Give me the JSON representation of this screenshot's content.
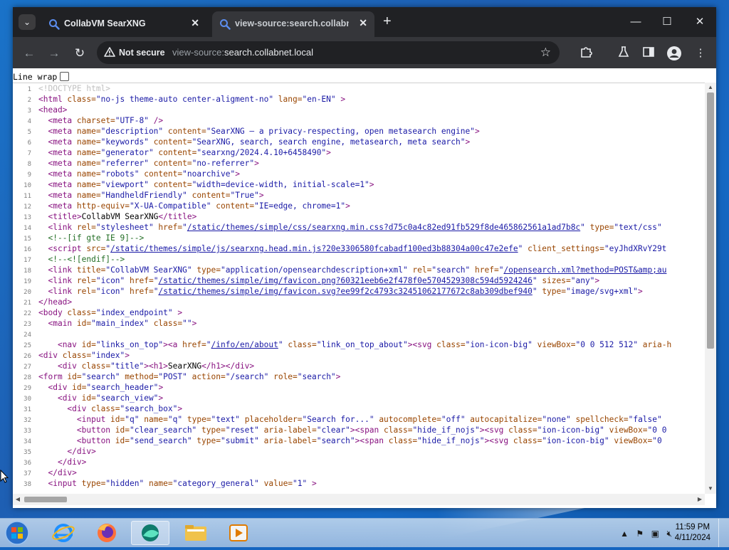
{
  "tabs": [
    {
      "title": "CollabVM SearXNG",
      "active": false
    },
    {
      "title": "view-source:search.collabnet.lo",
      "active": true
    }
  ],
  "window_controls": {
    "minimize": "—",
    "maximize": "☐",
    "close": "✕"
  },
  "address_bar": {
    "security_label": "Not secure",
    "url_scheme": "view-source:",
    "url_host": "search.collabnet.local"
  },
  "line_wrap_label": "Line wrap",
  "source_lines": [
    [
      [
        "doc",
        "<!DOCTYPE html>"
      ]
    ],
    [
      [
        "tag",
        "<html "
      ],
      [
        "attr",
        "class="
      ],
      [
        "val",
        "\"no-js theme-auto center-aligment-no\""
      ],
      [
        "attr",
        " lang="
      ],
      [
        "val",
        "\"en-EN\""
      ],
      [
        "tag",
        " >"
      ]
    ],
    [
      [
        "tag",
        "<head>"
      ]
    ],
    [
      [
        "txt",
        "  "
      ],
      [
        "tag",
        "<meta "
      ],
      [
        "attr",
        "charset="
      ],
      [
        "val",
        "\"UTF-8\""
      ],
      [
        "tag",
        " />"
      ]
    ],
    [
      [
        "txt",
        "  "
      ],
      [
        "tag",
        "<meta "
      ],
      [
        "attr",
        "name="
      ],
      [
        "val",
        "\"description\""
      ],
      [
        "attr",
        " content="
      ],
      [
        "val",
        "\"SearXNG — a privacy-respecting, open metasearch engine\""
      ],
      [
        "tag",
        ">"
      ]
    ],
    [
      [
        "txt",
        "  "
      ],
      [
        "tag",
        "<meta "
      ],
      [
        "attr",
        "name="
      ],
      [
        "val",
        "\"keywords\""
      ],
      [
        "attr",
        " content="
      ],
      [
        "val",
        "\"SearXNG, search, search engine, metasearch, meta search\""
      ],
      [
        "tag",
        ">"
      ]
    ],
    [
      [
        "txt",
        "  "
      ],
      [
        "tag",
        "<meta "
      ],
      [
        "attr",
        "name="
      ],
      [
        "val",
        "\"generator\""
      ],
      [
        "attr",
        " content="
      ],
      [
        "val",
        "\"searxng/2024.4.10+6458490\""
      ],
      [
        "tag",
        ">"
      ]
    ],
    [
      [
        "txt",
        "  "
      ],
      [
        "tag",
        "<meta "
      ],
      [
        "attr",
        "name="
      ],
      [
        "val",
        "\"referrer\""
      ],
      [
        "attr",
        " content="
      ],
      [
        "val",
        "\"no-referrer\""
      ],
      [
        "tag",
        ">"
      ]
    ],
    [
      [
        "txt",
        "  "
      ],
      [
        "tag",
        "<meta "
      ],
      [
        "attr",
        "name="
      ],
      [
        "val",
        "\"robots\""
      ],
      [
        "attr",
        " content="
      ],
      [
        "val",
        "\"noarchive\""
      ],
      [
        "tag",
        ">"
      ]
    ],
    [
      [
        "txt",
        "  "
      ],
      [
        "tag",
        "<meta "
      ],
      [
        "attr",
        "name="
      ],
      [
        "val",
        "\"viewport\""
      ],
      [
        "attr",
        " content="
      ],
      [
        "val",
        "\"width=device-width, initial-scale=1\""
      ],
      [
        "tag",
        ">"
      ]
    ],
    [
      [
        "txt",
        "  "
      ],
      [
        "tag",
        "<meta "
      ],
      [
        "attr",
        "name="
      ],
      [
        "val",
        "\"HandheldFriendly\""
      ],
      [
        "attr",
        " content="
      ],
      [
        "val",
        "\"True\""
      ],
      [
        "tag",
        ">"
      ]
    ],
    [
      [
        "txt",
        "  "
      ],
      [
        "tag",
        "<meta "
      ],
      [
        "attr",
        "http-equiv="
      ],
      [
        "val",
        "\"X-UA-Compatible\""
      ],
      [
        "attr",
        " content="
      ],
      [
        "val",
        "\"IE=edge, chrome=1\""
      ],
      [
        "tag",
        ">"
      ]
    ],
    [
      [
        "txt",
        "  "
      ],
      [
        "tag",
        "<title>"
      ],
      [
        "txt",
        "CollabVM SearXNG"
      ],
      [
        "tag",
        "</title>"
      ]
    ],
    [
      [
        "txt",
        "  "
      ],
      [
        "tag",
        "<link "
      ],
      [
        "attr",
        "rel="
      ],
      [
        "val",
        "\"stylesheet\""
      ],
      [
        "attr",
        " href="
      ],
      [
        "val",
        "\""
      ],
      [
        "link",
        "/static/themes/simple/css/searxng.min.css?d75c0a4c82ed91fb529f8de465862561a1ad7b8c"
      ],
      [
        "val",
        "\""
      ],
      [
        "attr",
        " type="
      ],
      [
        "val",
        "\"text/css\""
      ]
    ],
    [
      [
        "txt",
        "  "
      ],
      [
        "com",
        "<!--[if gte IE 9]-->"
      ]
    ],
    [
      [
        "txt",
        "  "
      ],
      [
        "tag",
        "<script "
      ],
      [
        "attr",
        "src="
      ],
      [
        "val",
        "\""
      ],
      [
        "link",
        "/static/themes/simple/js/searxng.head.min.js?20e3306580fcabadf100ed3b88304a00c47e2efe"
      ],
      [
        "val",
        "\""
      ],
      [
        "attr",
        " client_settings="
      ],
      [
        "val",
        "\"eyJhdXRvY29t"
      ]
    ],
    [
      [
        "txt",
        "  "
      ],
      [
        "com",
        "<!--<![endif]-->"
      ]
    ],
    [
      [
        "txt",
        "  "
      ],
      [
        "tag",
        "<link "
      ],
      [
        "attr",
        "title="
      ],
      [
        "val",
        "\"CollabVM SearXNG\""
      ],
      [
        "attr",
        " type="
      ],
      [
        "val",
        "\"application/opensearchdescription+xml\""
      ],
      [
        "attr",
        " rel="
      ],
      [
        "val",
        "\"search\""
      ],
      [
        "attr",
        " href="
      ],
      [
        "val",
        "\""
      ],
      [
        "link",
        "/opensearch.xml?method=POST&amp;au"
      ]
    ],
    [
      [
        "txt",
        "  "
      ],
      [
        "tag",
        "<link "
      ],
      [
        "attr",
        "rel="
      ],
      [
        "val",
        "\"icon\""
      ],
      [
        "attr",
        " href="
      ],
      [
        "val",
        "\""
      ],
      [
        "link",
        "/static/themes/simple/img/favicon.png?60321eeb6e2f478f0e5704529308c594d5924246"
      ],
      [
        "val",
        "\""
      ],
      [
        "attr",
        " sizes="
      ],
      [
        "val",
        "\"any\""
      ],
      [
        "tag",
        ">"
      ]
    ],
    [
      [
        "txt",
        "  "
      ],
      [
        "tag",
        "<link "
      ],
      [
        "attr",
        "rel="
      ],
      [
        "val",
        "\"icon\""
      ],
      [
        "attr",
        " href="
      ],
      [
        "val",
        "\""
      ],
      [
        "link",
        "/static/themes/simple/img/favicon.svg?ee99f2c4793c32451062177672c8ab309dbef940"
      ],
      [
        "val",
        "\""
      ],
      [
        "attr",
        " type="
      ],
      [
        "val",
        "\"image/svg+xml\""
      ],
      [
        "tag",
        ">"
      ]
    ],
    [
      [
        "tag",
        "</head>"
      ]
    ],
    [
      [
        "tag",
        "<body "
      ],
      [
        "attr",
        "class="
      ],
      [
        "val",
        "\"index_endpoint\""
      ],
      [
        "tag",
        " >"
      ]
    ],
    [
      [
        "txt",
        "  "
      ],
      [
        "tag",
        "<main "
      ],
      [
        "attr",
        "id="
      ],
      [
        "val",
        "\"main_index\""
      ],
      [
        "attr",
        " class="
      ],
      [
        "val",
        "\"\""
      ],
      [
        "tag",
        ">"
      ]
    ],
    [],
    [
      [
        "txt",
        "    "
      ],
      [
        "tag",
        "<nav "
      ],
      [
        "attr",
        "id="
      ],
      [
        "val",
        "\"links_on_top\""
      ],
      [
        "tag",
        "><a "
      ],
      [
        "attr",
        "href="
      ],
      [
        "val",
        "\""
      ],
      [
        "link",
        "/info/en/about"
      ],
      [
        "val",
        "\""
      ],
      [
        "attr",
        " class="
      ],
      [
        "val",
        "\"link_on_top_about\""
      ],
      [
        "tag",
        "><svg "
      ],
      [
        "attr",
        "class="
      ],
      [
        "val",
        "\"ion-icon-big\""
      ],
      [
        "attr",
        " viewBox="
      ],
      [
        "val",
        "\"0 0 512 512\""
      ],
      [
        "attr",
        " aria-h"
      ]
    ],
    [
      [
        "tag",
        "<div "
      ],
      [
        "attr",
        "class="
      ],
      [
        "val",
        "\"index\""
      ],
      [
        "tag",
        ">"
      ]
    ],
    [
      [
        "txt",
        "    "
      ],
      [
        "tag",
        "<div "
      ],
      [
        "attr",
        "class="
      ],
      [
        "val",
        "\"title\""
      ],
      [
        "tag",
        "><h1>"
      ],
      [
        "txt",
        "SearXNG"
      ],
      [
        "tag",
        "</h1></div>"
      ]
    ],
    [
      [
        "tag",
        "<form "
      ],
      [
        "attr",
        "id="
      ],
      [
        "val",
        "\"search\""
      ],
      [
        "attr",
        " method="
      ],
      [
        "val",
        "\"POST\""
      ],
      [
        "attr",
        " action="
      ],
      [
        "val",
        "\"/search\""
      ],
      [
        "attr",
        " role="
      ],
      [
        "val",
        "\"search\""
      ],
      [
        "tag",
        ">"
      ]
    ],
    [
      [
        "txt",
        "  "
      ],
      [
        "tag",
        "<div "
      ],
      [
        "attr",
        "id="
      ],
      [
        "val",
        "\"search_header\""
      ],
      [
        "tag",
        ">"
      ]
    ],
    [
      [
        "txt",
        "    "
      ],
      [
        "tag",
        "<div "
      ],
      [
        "attr",
        "id="
      ],
      [
        "val",
        "\"search_view\""
      ],
      [
        "tag",
        ">"
      ]
    ],
    [
      [
        "txt",
        "      "
      ],
      [
        "tag",
        "<div "
      ],
      [
        "attr",
        "class="
      ],
      [
        "val",
        "\"search_box\""
      ],
      [
        "tag",
        ">"
      ]
    ],
    [
      [
        "txt",
        "        "
      ],
      [
        "tag",
        "<input "
      ],
      [
        "attr",
        "id="
      ],
      [
        "val",
        "\"q\""
      ],
      [
        "attr",
        " name="
      ],
      [
        "val",
        "\"q\""
      ],
      [
        "attr",
        " type="
      ],
      [
        "val",
        "\"text\""
      ],
      [
        "attr",
        " placeholder="
      ],
      [
        "val",
        "\"Search for...\""
      ],
      [
        "attr",
        " autocomplete="
      ],
      [
        "val",
        "\"off\""
      ],
      [
        "attr",
        " autocapitalize="
      ],
      [
        "val",
        "\"none\""
      ],
      [
        "attr",
        " spellcheck="
      ],
      [
        "val",
        "\"false\""
      ]
    ],
    [
      [
        "txt",
        "        "
      ],
      [
        "tag",
        "<button "
      ],
      [
        "attr",
        "id="
      ],
      [
        "val",
        "\"clear_search\""
      ],
      [
        "attr",
        " type="
      ],
      [
        "val",
        "\"reset\""
      ],
      [
        "attr",
        " aria-label="
      ],
      [
        "val",
        "\"clear\""
      ],
      [
        "tag",
        "><span "
      ],
      [
        "attr",
        "class="
      ],
      [
        "val",
        "\"hide_if_nojs\""
      ],
      [
        "tag",
        "><svg "
      ],
      [
        "attr",
        "class="
      ],
      [
        "val",
        "\"ion-icon-big\""
      ],
      [
        "attr",
        " viewBox="
      ],
      [
        "val",
        "\"0 0"
      ]
    ],
    [
      [
        "txt",
        "        "
      ],
      [
        "tag",
        "<button "
      ],
      [
        "attr",
        "id="
      ],
      [
        "val",
        "\"send_search\""
      ],
      [
        "attr",
        " type="
      ],
      [
        "val",
        "\"submit\""
      ],
      [
        "attr",
        " aria-label="
      ],
      [
        "val",
        "\"search\""
      ],
      [
        "tag",
        "><span "
      ],
      [
        "attr",
        "class="
      ],
      [
        "val",
        "\"hide_if_nojs\""
      ],
      [
        "tag",
        "><svg "
      ],
      [
        "attr",
        "class="
      ],
      [
        "val",
        "\"ion-icon-big\""
      ],
      [
        "attr",
        " viewBox="
      ],
      [
        "val",
        "\"0"
      ]
    ],
    [
      [
        "txt",
        "      "
      ],
      [
        "tag",
        "</div>"
      ]
    ],
    [
      [
        "txt",
        "    "
      ],
      [
        "tag",
        "</div>"
      ]
    ],
    [
      [
        "txt",
        "  "
      ],
      [
        "tag",
        "</div>"
      ]
    ],
    [
      [
        "txt",
        "  "
      ],
      [
        "tag",
        "<input "
      ],
      [
        "attr",
        "type="
      ],
      [
        "val",
        "\"hidden\""
      ],
      [
        "attr",
        " name="
      ],
      [
        "val",
        "\"category_general\""
      ],
      [
        "attr",
        " value="
      ],
      [
        "val",
        "\"1\""
      ],
      [
        "tag",
        " >"
      ]
    ]
  ],
  "clock": {
    "time": "11:59 PM",
    "date": "4/11/2024"
  },
  "colors": {
    "tag": "#881280",
    "attr": "#994500",
    "value": "#1a1aa6",
    "comment": "#236e25",
    "doctype": "#c0c0c0",
    "chrome_dark": "#202124",
    "chrome_toolbar": "#35363a"
  },
  "icons": {
    "tab_search": "chevron-down-icon",
    "tab_favicon": "search-icon",
    "back": "arrow-left-icon",
    "forward": "arrow-right-icon",
    "reload": "reload-icon",
    "warning": "warning-icon",
    "bookmark": "star-icon",
    "extensions": "puzzle-icon",
    "labs": "flask-icon",
    "side_panel": "side-panel-icon",
    "profile": "profile-icon",
    "menu": "kebab-menu-icon"
  }
}
